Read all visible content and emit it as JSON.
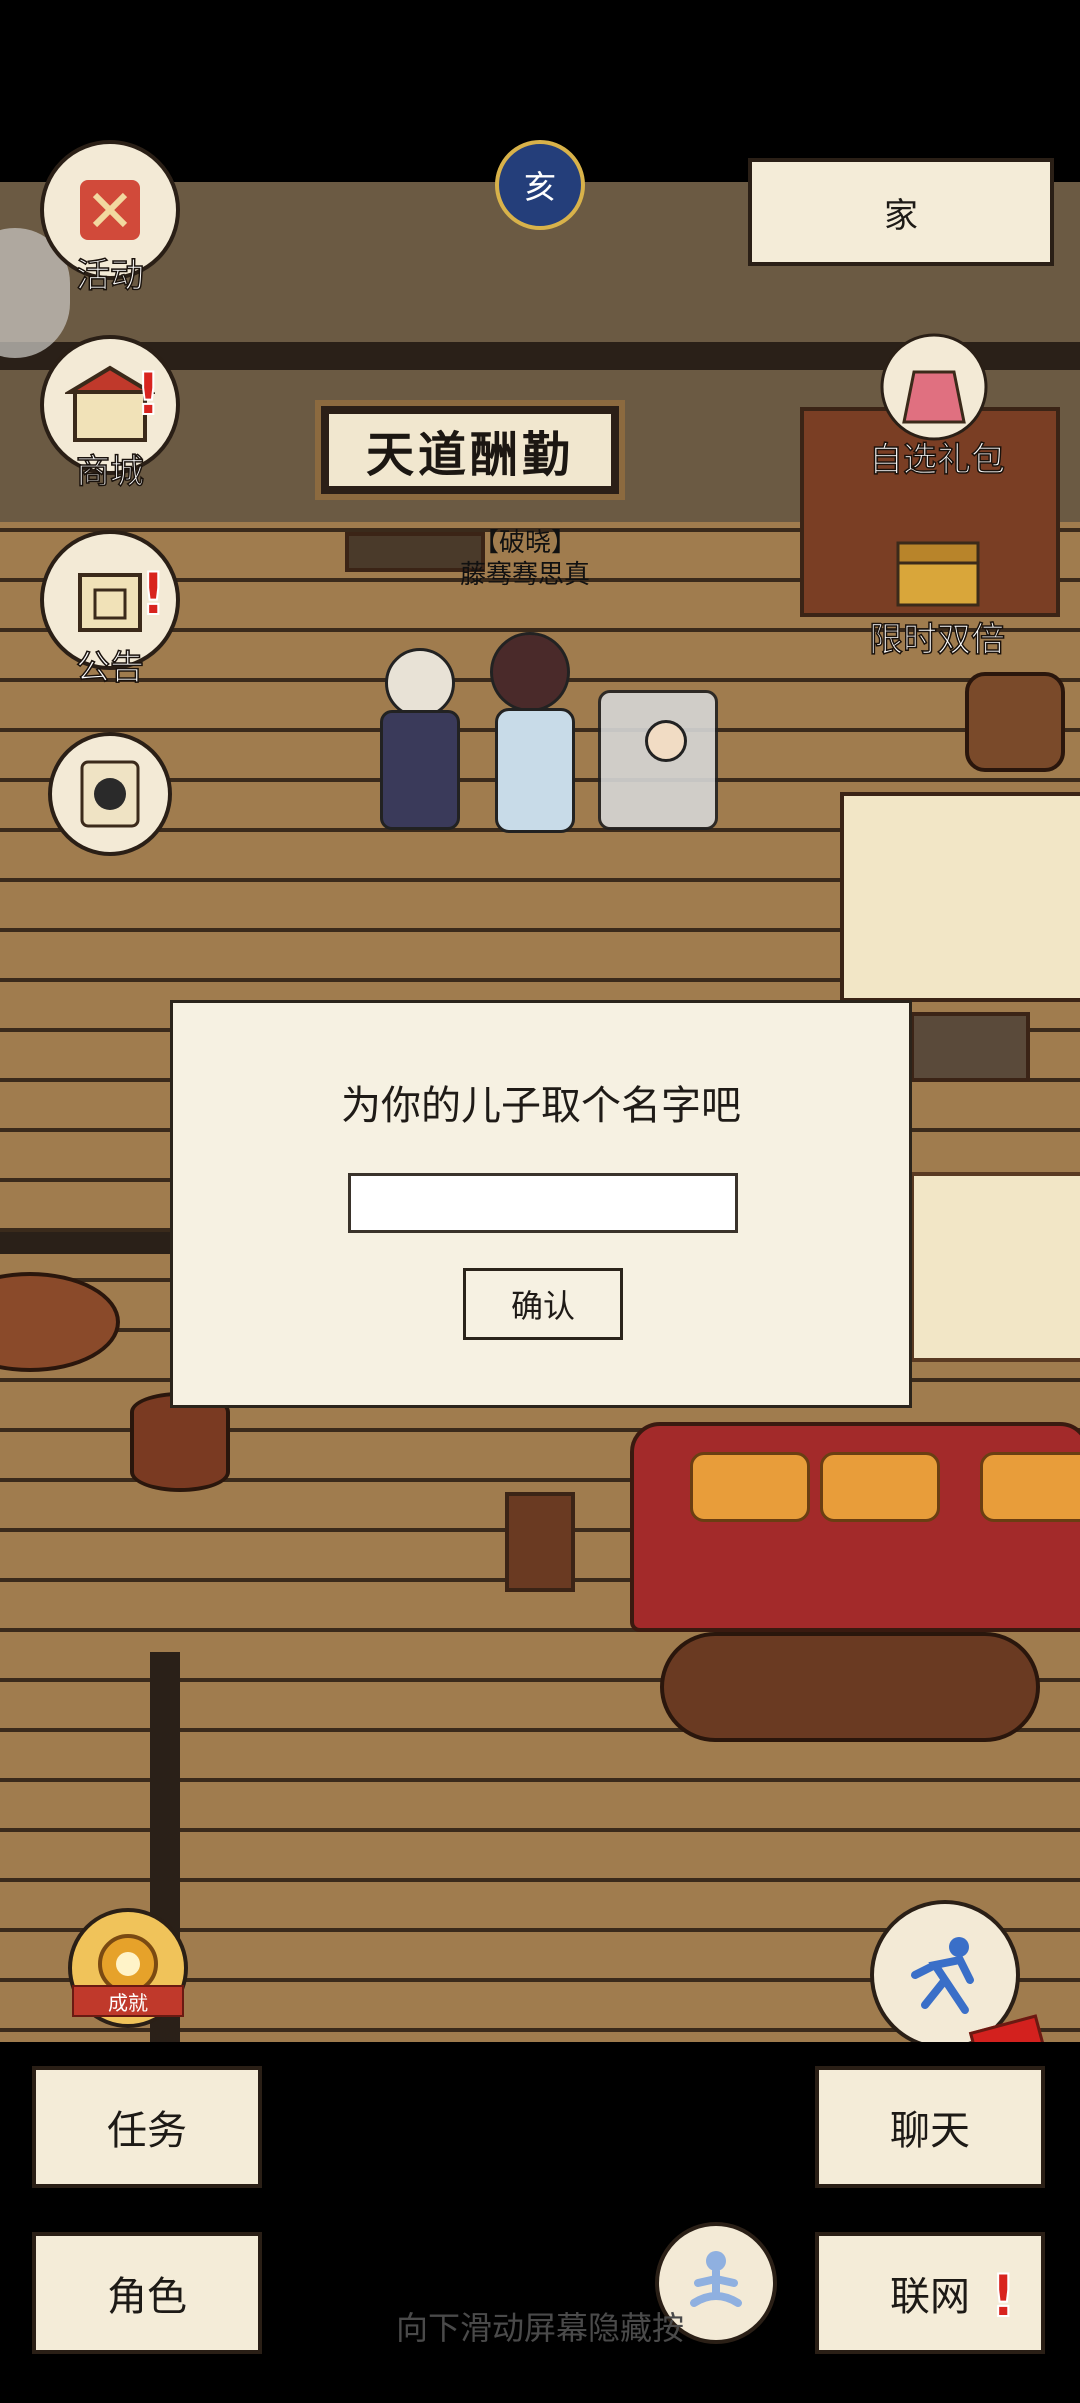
{
  "top": {
    "home_label": "家",
    "time_glyph": "亥"
  },
  "scene": {
    "plaque_text": "天道酬勤",
    "character_title": "【破晓】",
    "character_name": "藤骞骞思真"
  },
  "side_menu": [
    {
      "label": "活动"
    },
    {
      "label": "商城"
    },
    {
      "label": "公告"
    }
  ],
  "right_menu": [
    {
      "label": "自选礼包"
    },
    {
      "label": "限时双倍"
    }
  ],
  "dialog": {
    "title": "为你的儿子取个名字吧",
    "input_value": "",
    "confirm_label": "确认"
  },
  "bottom": {
    "task_label": "任务",
    "chat_label": "聊天",
    "role_label": "角色",
    "network_label": "联网",
    "achievement_label": "成就",
    "hint": "向下滑动屏幕隐藏按"
  },
  "colors": {
    "alert": "#d8241f",
    "panel": "#f4ecd8",
    "wood": "#a07c4e"
  }
}
